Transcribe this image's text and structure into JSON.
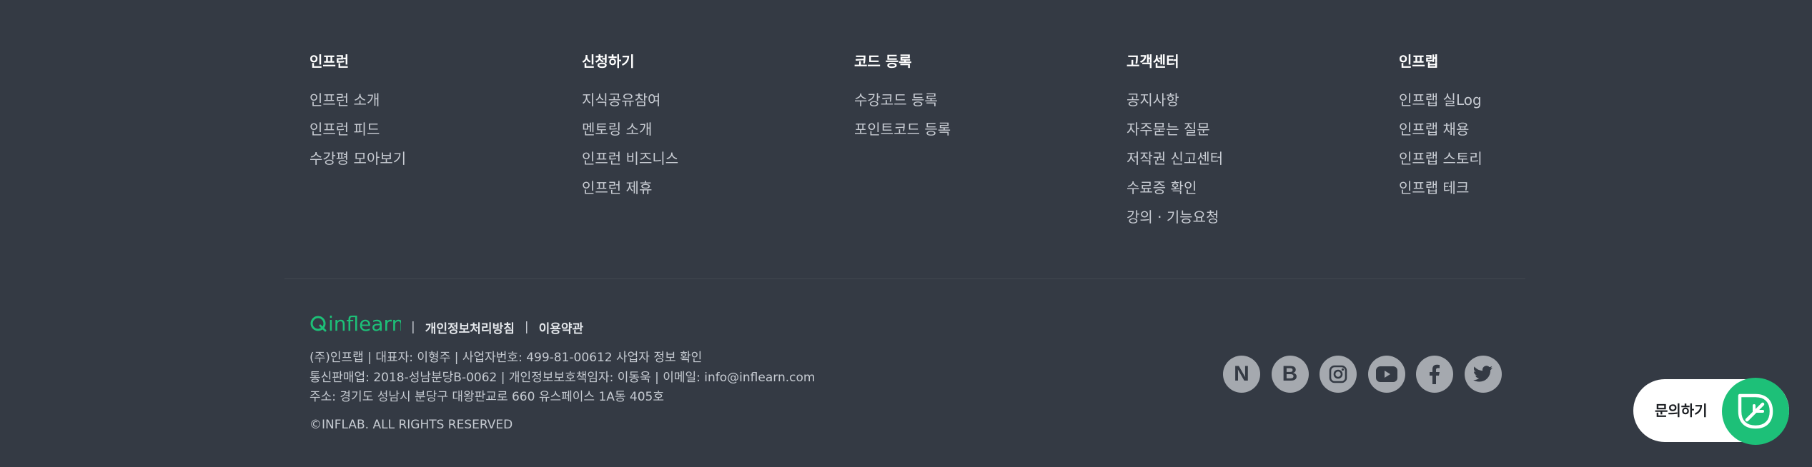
{
  "columns": [
    {
      "title": "인프런",
      "links": [
        "인프런 소개",
        "인프런 피드",
        "수강평 모아보기"
      ]
    },
    {
      "title": "신청하기",
      "links": [
        "지식공유참여",
        "멘토링 소개",
        "인프런 비즈니스",
        "인프런 제휴"
      ]
    },
    {
      "title": "코드 등록",
      "links": [
        "수강코드 등록",
        "포인트코드 등록"
      ]
    },
    {
      "title": "고객센터",
      "links": [
        "공지사항",
        "자주묻는 질문",
        "저작권 신고센터",
        "수료증 확인",
        "강의 · 기능요청"
      ]
    },
    {
      "title": "인프랩",
      "links": [
        "인프랩 실Log",
        "인프랩 채용",
        "인프랩 스토리",
        "인프랩 테크"
      ]
    }
  ],
  "brand": {
    "logo_text": "inflearn",
    "separator": "|",
    "privacy": "개인정보처리방침",
    "terms": "이용약관"
  },
  "company": {
    "line1": "(주)인프랩 | 대표자: 이형주 | 사업자번호: 499-81-00612 사업자 정보 확인",
    "line2": "통신판매업: 2018-성남분당B-0062 | 개인정보보호책임자: 이동욱 | 이메일: info@inflearn.com",
    "line3": "주소: 경기도 성남시 분당구 대왕판교로 660 유스페이스 1A동 405호",
    "copyright": "©INFLAB. ALL RIGHTS RESERVED"
  },
  "social": {
    "naver": "N",
    "blog": "B",
    "icons": [
      "naver-icon",
      "blog-icon",
      "instagram-icon",
      "youtube-icon",
      "facebook-icon",
      "twitter-icon"
    ]
  },
  "inquiry": {
    "label": "문의하기"
  },
  "colors": {
    "background": "#343a44",
    "accent": "#1dc078",
    "social_bg": "#a5a9af"
  }
}
